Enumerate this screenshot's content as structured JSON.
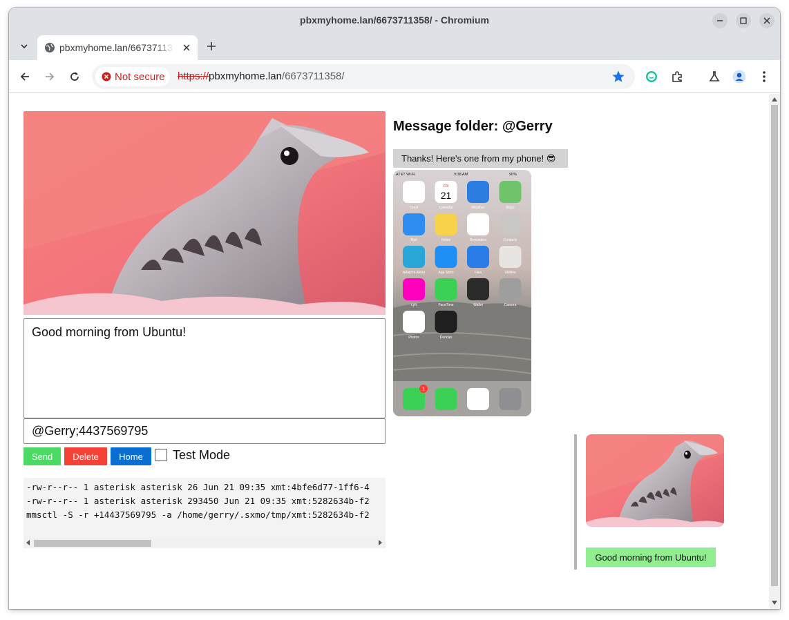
{
  "window": {
    "title": "pbxmyhome.lan/6673711358/ - Chromium"
  },
  "tabs": [
    {
      "title": "pbxmyhome.lan/6673711358/",
      "active": true
    }
  ],
  "toolbar": {
    "security_label": "Not secure",
    "url_scheme": "https://",
    "url_host": "pbxmyhome.lan",
    "url_path": "/6673711358/"
  },
  "compose": {
    "message": "Good morning from Ubuntu!",
    "recipients": "@Gerry;4437569795",
    "send_label": "Send",
    "delete_label": "Delete",
    "home_label": "Home",
    "test_mode_label": "Test Mode",
    "test_mode_checked": false
  },
  "log": {
    "lines": [
      "-rw-r--r-- 1 asterisk asterisk 26 Jun 21 09:35 xmt:4bfe6d77-1ff6-4",
      "-rw-r--r-- 1 asterisk asterisk 293450 Jun 21 09:35 xmt:5282634b-f2",
      "mmsctl -S -r +14437569795 -a /home/gerry/.sxmo/tmp/xmt:5282634b-f2"
    ]
  },
  "conversation": {
    "folder_title": "Message folder: @Gerry",
    "incoming_text": "Thanks! Here's one from my phone! 😎",
    "outgoing_text": "Good morning from Ubuntu!"
  },
  "phone_screenshot": {
    "status_left": "AT&T Wi-Fi",
    "status_time": "9:38 AM",
    "status_right": "96%",
    "calendar_day": "FRI",
    "calendar_date": "21",
    "messages_badge": "1",
    "apps": [
      "Clock",
      "Calendar",
      "Weather",
      "Maps",
      "Mail",
      "Notes",
      "Reminders",
      "Contacts",
      "Amazon Alexa",
      "App Store",
      "Files",
      "Utilities",
      "Lyft",
      "FaceTime",
      "Wallet",
      "Camera",
      "Photos",
      "Duncan"
    ],
    "dock": [
      "Messages",
      "Phone",
      "Safari",
      "Settings"
    ]
  },
  "colors": {
    "send": "#4cd964",
    "delete": "#f44336",
    "home": "#0a6ed1",
    "bubble_in": "#d3d3d3",
    "bubble_out": "#90ee90",
    "not_secure": "#c5221f",
    "star": "#1a73e8"
  }
}
